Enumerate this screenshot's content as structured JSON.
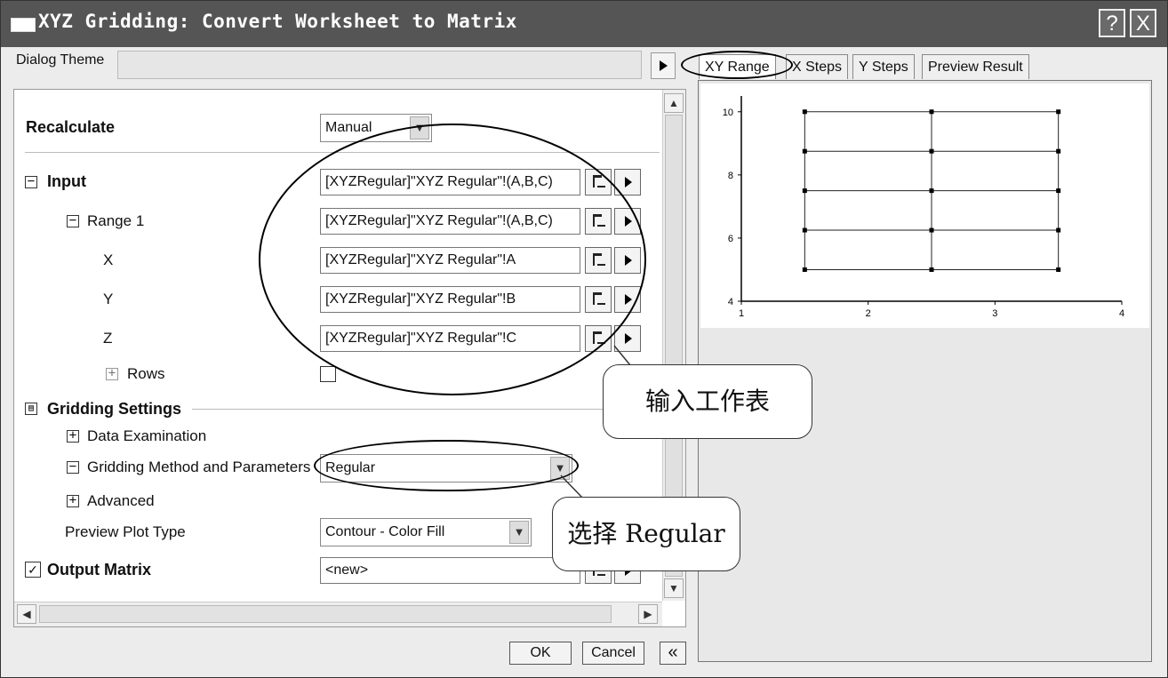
{
  "window": {
    "title": "XYZ Gridding: Convert Worksheet to Matrix",
    "help_label": "?",
    "close_label": "X"
  },
  "dialog_theme": {
    "label": "Dialog Theme",
    "value": ""
  },
  "settings": {
    "recalculate": {
      "label": "Recalculate",
      "value": "Manual"
    },
    "input": {
      "label": "Input",
      "value": "[XYZRegular]\"XYZ Regular\"!(A,B,C)",
      "range1": {
        "label": "Range 1",
        "value": "[XYZRegular]\"XYZ Regular\"!(A,B,C)"
      },
      "x": {
        "label": "X",
        "value": "[XYZRegular]\"XYZ Regular\"!A"
      },
      "y": {
        "label": "Y",
        "value": "[XYZRegular]\"XYZ Regular\"!B"
      },
      "z": {
        "label": "Z",
        "value": "[XYZRegular]\"XYZ Regular\"!C"
      },
      "rows": {
        "label": "Rows"
      }
    },
    "gridding": {
      "label": "Gridding Settings",
      "data_examination": {
        "label": "Data Examination"
      },
      "method": {
        "label": "Gridding Method and Parameters",
        "value": "Regular"
      },
      "advanced": {
        "label": "Advanced"
      },
      "preview_plot_type": {
        "label": "Preview Plot Type",
        "value": "Contour - Color Fill"
      }
    },
    "output_matrix": {
      "label": "Output Matrix",
      "value": "<new>",
      "checked": true
    }
  },
  "tabs": [
    {
      "label": "XY Range",
      "active": true
    },
    {
      "label": "X Steps"
    },
    {
      "label": "Y Steps"
    },
    {
      "label": "Preview Result"
    }
  ],
  "preview": {
    "x_ticks": [
      "1",
      "2",
      "3",
      "4"
    ],
    "y_ticks": [
      "4",
      "6",
      "8",
      "10"
    ],
    "x_range": [
      1,
      4
    ],
    "y_range": [
      4,
      10.5
    ],
    "grid_x": [
      1.5,
      2.5,
      3.5
    ],
    "grid_y": [
      5,
      6.25,
      7.5,
      8.75,
      10
    ]
  },
  "buttons": {
    "ok": "OK",
    "cancel": "Cancel",
    "collapse": "«"
  },
  "annotations": {
    "callout_input": "输入工作表",
    "callout_regular": "选择 Regular"
  }
}
